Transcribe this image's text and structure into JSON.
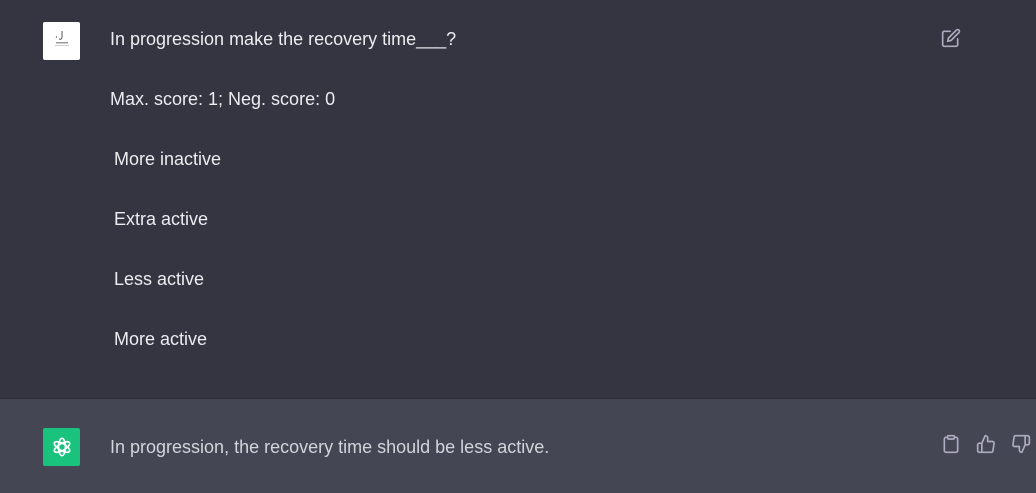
{
  "user_message": {
    "question": "In progression make the recovery time___?",
    "score_info": "Max. score: 1; Neg. score: 0",
    "options": [
      "More inactive",
      "Extra active",
      "Less active",
      "More active"
    ]
  },
  "assistant_message": {
    "text": "In progression, the recovery time should be less active."
  },
  "icons": {
    "edit": "edit-icon",
    "copy": "clipboard-icon",
    "like": "thumbs-up-icon",
    "dislike": "thumbs-down-icon",
    "assistant_logo": "openai-logo-icon",
    "user_avatar": "user-avatar"
  },
  "colors": {
    "user_bg": "#343541",
    "assistant_bg": "#444654",
    "assistant_avatar_bg": "#19c37d",
    "text": "#ececf1"
  }
}
